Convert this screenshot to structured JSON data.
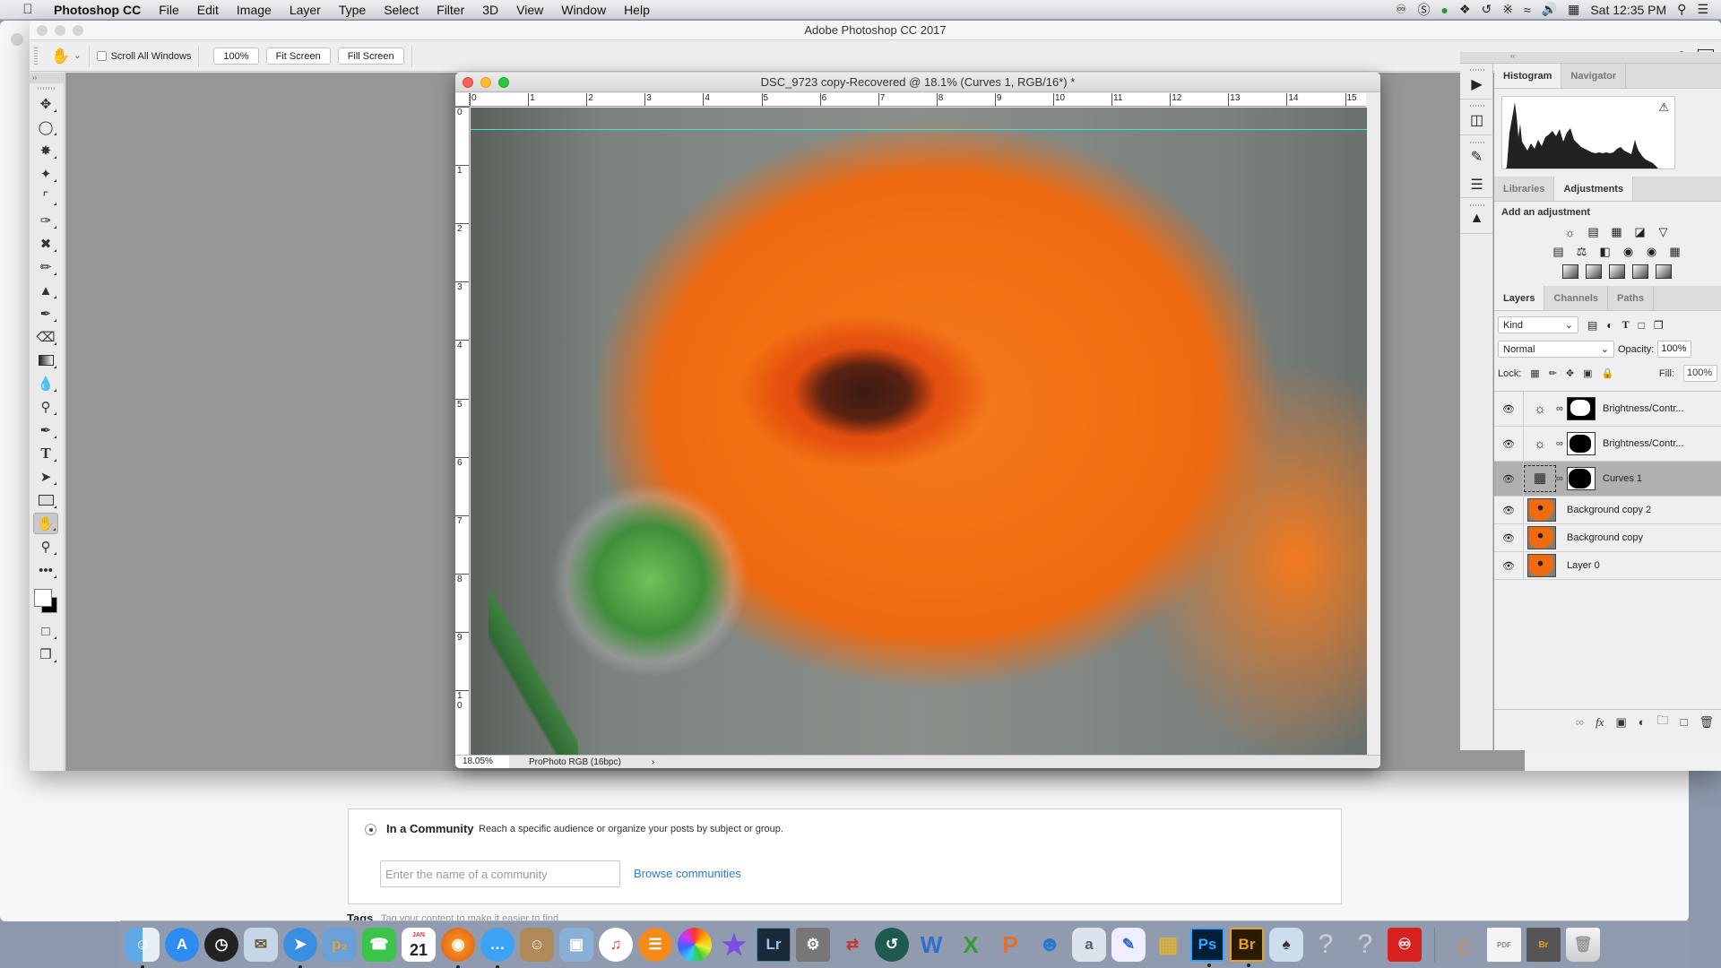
{
  "menubar": {
    "app_name": "Photoshop CC",
    "items": [
      "File",
      "Edit",
      "Image",
      "Layer",
      "Type",
      "Select",
      "Filter",
      "3D",
      "View",
      "Window",
      "Help"
    ],
    "status_icons": [
      "creative-cloud-icon",
      "s-shield-icon",
      "green-app-icon",
      "dropbox-icon",
      "time-machine-icon",
      "bluetooth-icon",
      "battery-icon",
      "wifi-icon",
      "volume-icon",
      "keyboard-icon"
    ],
    "clock": "Sat 12:35 PM"
  },
  "photoshop": {
    "window_title": "Adobe Photoshop CC 2017",
    "options_bar": {
      "scroll_all_label": "Scroll All Windows",
      "scroll_all_checked": false,
      "zoom_100_label": "100%",
      "fit_screen_label": "Fit Screen",
      "fill_screen_label": "Fill Screen"
    },
    "tools": [
      "move",
      "marquee",
      "lasso",
      "magic-wand",
      "crop",
      "eyedropper",
      "healing",
      "brush",
      "clone-stamp",
      "history-brush",
      "eraser",
      "gradient",
      "blur",
      "dodge",
      "pen",
      "type",
      "path-select",
      "rectangle",
      "hand",
      "zoom",
      "more"
    ],
    "active_tool": "hand",
    "document": {
      "title": "DSC_9723 copy-Recovered @ 18.1% (Curves 1, RGB/16*) *",
      "h_ruler": [
        "0",
        "1",
        "2",
        "3",
        "4",
        "5",
        "6",
        "7",
        "8",
        "9",
        "10",
        "11",
        "12",
        "13",
        "14",
        "15"
      ],
      "v_ruler": [
        "0",
        "1",
        "2",
        "3",
        "4",
        "5",
        "6",
        "7",
        "8",
        "9",
        "1\n0"
      ],
      "zoom": "18.05%",
      "profile": "ProPhoto RGB (16bpc)",
      "status_arrow": "›"
    },
    "panels": {
      "histogram_tabs": [
        "Histogram",
        "Navigator"
      ],
      "adjust_tabs": [
        "Libraries",
        "Adjustments"
      ],
      "add_adjustment_label": "Add an adjustment",
      "layer_tabs": [
        "Layers",
        "Channels",
        "Paths"
      ],
      "kind_label": "Kind",
      "blend_mode": "Normal",
      "opacity_label": "Opacity:",
      "opacity_value": "100%",
      "lock_label": "Lock:",
      "fill_label": "Fill:",
      "fill_value": "100%",
      "layers": [
        {
          "name": "Brightness/Contr...",
          "type": "adjustment",
          "visible": true,
          "selected": false
        },
        {
          "name": "Brightness/Contr...",
          "type": "adjustment",
          "visible": true,
          "selected": false
        },
        {
          "name": "Curves 1",
          "type": "curves",
          "visible": true,
          "selected": true
        },
        {
          "name": "Background copy 2",
          "type": "pixel",
          "visible": true,
          "selected": false
        },
        {
          "name": "Background copy",
          "type": "pixel",
          "visible": true,
          "selected": false
        },
        {
          "name": "Layer 0",
          "type": "pixel",
          "visible": true,
          "selected": false
        }
      ]
    }
  },
  "web_page": {
    "community_title": "In a Community",
    "community_desc": "Reach a specific audience or organize your posts by subject or group.",
    "community_placeholder": "Enter the name of a community",
    "browse_link": "Browse communities",
    "tags_label": "Tags",
    "tags_desc": "Tag your content to make it easier to find"
  },
  "dock": {
    "apps": [
      "Finder",
      "App Store",
      "Dashboard",
      "Mail",
      "Safari",
      "Preview",
      "FaceTime",
      "Calendar",
      "Firefox",
      "Messages",
      "Contacts",
      "Image Capture",
      "iTunes",
      "iBooks",
      "Photos",
      "iMovie",
      "Lightroom",
      "System Preferences",
      "Migration",
      "Time Machine",
      "Word",
      "Excel",
      "PowerPoint",
      "Messenger",
      "Font Book",
      "Pages",
      "Archive Utility",
      "Photoshop",
      "Bridge",
      "Game",
      "Unknown",
      "Unknown",
      "Creative Cloud",
      "Home",
      "PDF",
      "Bridge Doc",
      "Trash"
    ],
    "calendar_month": "JAN",
    "calendar_day": "21",
    "lr_label": "Lr",
    "ps_label": "Ps",
    "br_label": "Br"
  }
}
